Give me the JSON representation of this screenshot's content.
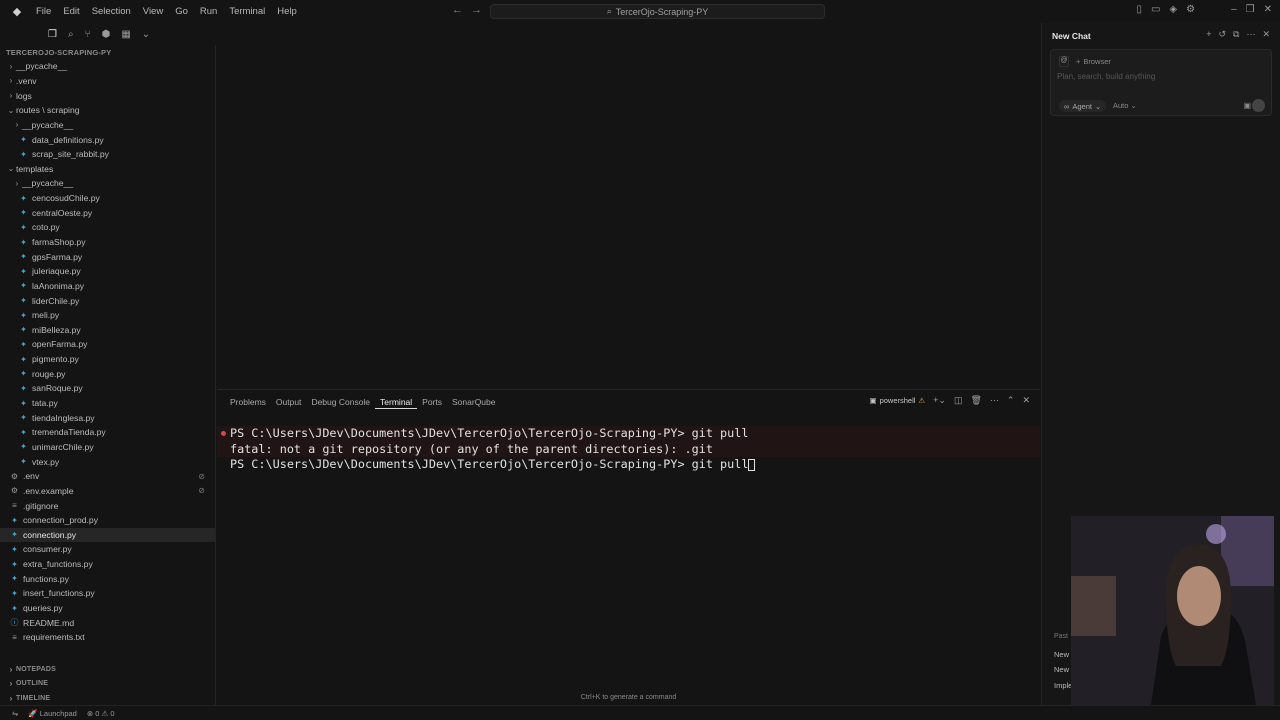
{
  "menu": [
    "File",
    "Edit",
    "Selection",
    "View",
    "Go",
    "Run",
    "Terminal",
    "Help"
  ],
  "command_center": {
    "label": "TercerOjo-Scraping-PY"
  },
  "explorer": {
    "root": "TERCEROJO-SCRAPING-PY",
    "items": [
      {
        "name": "__pycache__",
        "kind": "folder",
        "indent": 0,
        "open": false
      },
      {
        "name": ".venv",
        "kind": "folder",
        "indent": 0,
        "open": false
      },
      {
        "name": "logs",
        "kind": "folder",
        "indent": 0,
        "open": false
      },
      {
        "name": "routes \\ scraping",
        "kind": "folder",
        "indent": 0,
        "open": true
      },
      {
        "name": "__pycache__",
        "kind": "folder",
        "indent": 1,
        "open": false
      },
      {
        "name": "data_definitions.py",
        "kind": "py",
        "indent": 1
      },
      {
        "name": "scrap_site_rabbit.py",
        "kind": "py",
        "indent": 1
      },
      {
        "name": "templates",
        "kind": "folder",
        "indent": 0,
        "open": true
      },
      {
        "name": "__pycache__",
        "kind": "folder",
        "indent": 1,
        "open": false
      },
      {
        "name": "cencosudChile.py",
        "kind": "py",
        "indent": 1
      },
      {
        "name": "centralOeste.py",
        "kind": "py",
        "indent": 1
      },
      {
        "name": "coto.py",
        "kind": "py",
        "indent": 1
      },
      {
        "name": "farmaShop.py",
        "kind": "py",
        "indent": 1
      },
      {
        "name": "gpsFarma.py",
        "kind": "py",
        "indent": 1
      },
      {
        "name": "juleriaque.py",
        "kind": "py",
        "indent": 1
      },
      {
        "name": "laAnonima.py",
        "kind": "py",
        "indent": 1
      },
      {
        "name": "liderChile.py",
        "kind": "py",
        "indent": 1
      },
      {
        "name": "meli.py",
        "kind": "py",
        "indent": 1
      },
      {
        "name": "miBelleza.py",
        "kind": "py",
        "indent": 1
      },
      {
        "name": "openFarma.py",
        "kind": "py",
        "indent": 1
      },
      {
        "name": "pigmento.py",
        "kind": "py",
        "indent": 1
      },
      {
        "name": "rouge.py",
        "kind": "py",
        "indent": 1
      },
      {
        "name": "sanRoque.py",
        "kind": "py",
        "indent": 1
      },
      {
        "name": "tata.py",
        "kind": "py",
        "indent": 1
      },
      {
        "name": "tiendaInglesa.py",
        "kind": "py",
        "indent": 1
      },
      {
        "name": "tremendaTienda.py",
        "kind": "py",
        "indent": 1
      },
      {
        "name": "unimarcChile.py",
        "kind": "py",
        "indent": 1
      },
      {
        "name": "vtex.py",
        "kind": "py",
        "indent": 1
      },
      {
        "name": ".env",
        "kind": "env",
        "indent": 0,
        "gear": true
      },
      {
        "name": ".env.example",
        "kind": "env",
        "indent": 0,
        "gear": true
      },
      {
        "name": ".gitignore",
        "kind": "txt",
        "indent": 0
      },
      {
        "name": "connection_prod.py",
        "kind": "py",
        "indent": 0
      },
      {
        "name": "connection.py",
        "kind": "py",
        "indent": 0,
        "selected": true
      },
      {
        "name": "consumer.py",
        "kind": "py",
        "indent": 0
      },
      {
        "name": "extra_functions.py",
        "kind": "py",
        "indent": 0
      },
      {
        "name": "functions.py",
        "kind": "py",
        "indent": 0
      },
      {
        "name": "insert_functions.py",
        "kind": "py",
        "indent": 0
      },
      {
        "name": "queries.py",
        "kind": "py",
        "indent": 0
      },
      {
        "name": "README.md",
        "kind": "md",
        "indent": 0
      },
      {
        "name": "requirements.txt",
        "kind": "txt",
        "indent": 0
      }
    ],
    "sections": [
      "NOTEPADS",
      "OUTLINE",
      "TIMELINE"
    ]
  },
  "panel": {
    "tabs": [
      "Problems",
      "Output",
      "Debug Console",
      "Terminal",
      "Ports",
      "SonarQube"
    ],
    "active_tab": "Terminal",
    "shell": "powershell",
    "terminal_lines": [
      {
        "text": "PS C:\\Users\\JDev\\Documents\\JDev\\TercerOjo\\TercerOjo-Scraping-PY> git pull",
        "error": true
      },
      {
        "text": "fatal: not a git repository (or any of the parent directories): .git",
        "error": true
      },
      {
        "text": "PS C:\\Users\\JDev\\Documents\\JDev\\TercerOjo\\TercerOjo-Scraping-PY> git pull",
        "error": false,
        "cursor": true
      }
    ],
    "hint": "Ctrl+K to generate a command"
  },
  "chat": {
    "title": "New Chat",
    "browser_chip": "Browser",
    "placeholder": "Plan, search, build anything",
    "mode": "Agent",
    "model": "Auto",
    "past_label": "Past",
    "past_items": [
      "New",
      "New",
      "Imple"
    ]
  },
  "status": {
    "launchpad": "Launchpad",
    "errors": "0",
    "warnings": "0"
  },
  "colors": {
    "background": "#141414",
    "py_icon": "#4aa3c8",
    "error_dot": "#d94848",
    "warning": "#d7a24b"
  }
}
